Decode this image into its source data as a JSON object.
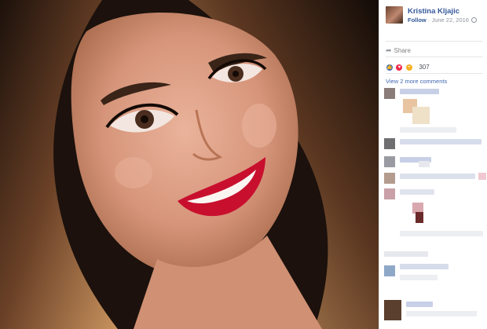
{
  "post": {
    "author": "Kristina Kljajic",
    "follow_label": "Follow",
    "separator": "·",
    "date": "June 22, 2016"
  },
  "actions": {
    "share_label": "Share"
  },
  "reactions": {
    "count": "307",
    "types": [
      "like",
      "love",
      "wow"
    ]
  },
  "comments": {
    "view_more_label": "View 2 more comments"
  },
  "colors": {
    "link": "#365899",
    "meta": "#90949c",
    "lips": "#c8102e"
  },
  "icons": {
    "share": "share-arrow-icon",
    "privacy": "globe-icon"
  }
}
